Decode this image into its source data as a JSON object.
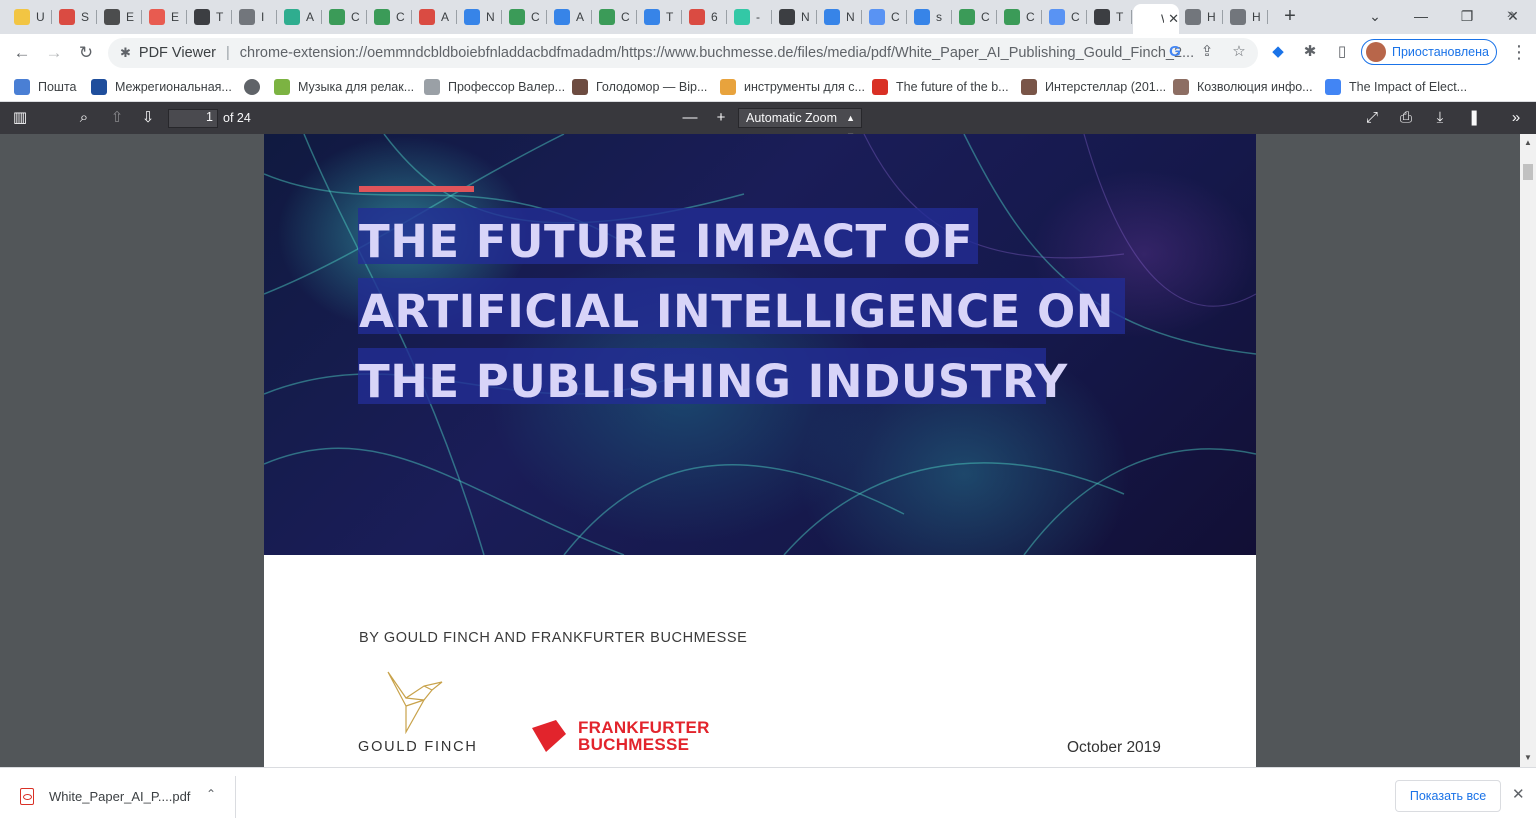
{
  "tabs": [
    {
      "title": "U",
      "color": "#f6c026"
    },
    {
      "title": "S",
      "color": "#d93025"
    },
    {
      "title": "E",
      "color": "#333333"
    },
    {
      "title": "E",
      "color": "#ea4335"
    },
    {
      "title": "T",
      "color": "#202124"
    },
    {
      "title": "I",
      "color": "#5f6368"
    },
    {
      "title": "A",
      "color": "#10a37f"
    },
    {
      "title": "C",
      "color": "#1e8e3e"
    },
    {
      "title": "C",
      "color": "#1e8e3e"
    },
    {
      "title": "A",
      "color": "#d93025"
    },
    {
      "title": "N",
      "color": "#1a73e8"
    },
    {
      "title": "C",
      "color": "#1e8e3e"
    },
    {
      "title": "A",
      "color": "#1a73e8"
    },
    {
      "title": "C",
      "color": "#1e8e3e"
    },
    {
      "title": "T",
      "color": "#1a73e8"
    },
    {
      "title": "6",
      "color": "#d93025"
    },
    {
      "title": "-",
      "color": "#15c39a"
    },
    {
      "title": "N",
      "color": "#202124"
    },
    {
      "title": "N",
      "color": "#1a73e8"
    },
    {
      "title": "C",
      "color": "#4285f4"
    },
    {
      "title": "s",
      "color": "#1a73e8"
    },
    {
      "title": "C",
      "color": "#1e8e3e"
    },
    {
      "title": "C",
      "color": "#1e8e3e"
    },
    {
      "title": "C",
      "color": "#4285f4"
    },
    {
      "title": "T",
      "color": "#202124"
    },
    {
      "title": "W",
      "color": "#ffffff",
      "active": true
    },
    {
      "title": "H",
      "color": "#5f6368"
    },
    {
      "title": "H",
      "color": "#5f6368"
    }
  ],
  "omnibox": {
    "chip": "PDF Viewer",
    "url": "chrome-extension://oemmndcbldboiebfnladdacbdfmadadm/https://www.buchmesse.de/files/media/pdf/White_Paper_AI_Publishing_Gould_Finch_2..."
  },
  "profile": {
    "label": "Приостановлена"
  },
  "bookmarks": [
    {
      "label": "Пошта",
      "color": "#4a7fd4"
    },
    {
      "label": "Межрегиональная...",
      "color": "#1f4e9c"
    },
    {
      "label": "",
      "color": "#5f6368"
    },
    {
      "label": "Музыка для релак...",
      "color": "#7cb342"
    },
    {
      "label": "Профессор Валер...",
      "color": "#9aa0a6"
    },
    {
      "label": "Голодомор — Віp...",
      "color": "#6d4c41"
    },
    {
      "label": "инструменты для с...",
      "color": "#e8a33d"
    },
    {
      "label": "The future of the b...",
      "color": "#d93025"
    },
    {
      "label": "Интерстеллар (201...",
      "color": "#795548"
    },
    {
      "label": "Козволюция инфо...",
      "color": "#8d6e63"
    },
    {
      "label": "The Impact of Elect...",
      "color": "#4285f4"
    }
  ],
  "pdf_toolbar": {
    "page_current": "1",
    "page_total_label": "of 24",
    "zoom": "Automatic Zoom"
  },
  "document": {
    "title_lines": [
      "THE FUTURE IMPACT OF",
      "ARTIFICIAL INTELLIGENCE ON",
      "THE PUBLISHING INDUSTRY"
    ],
    "byline": "BY GOULD FINCH AND FRANKFURTER BUCHMESSE",
    "logo1": "GOULD FINCH",
    "logo2_line1": "FRANKFURTER",
    "logo2_line2": "BUCHMESSE",
    "date": "October 2019"
  },
  "download": {
    "filename": "White_Paper_AI_P....pdf",
    "show_all": "Показать все"
  }
}
